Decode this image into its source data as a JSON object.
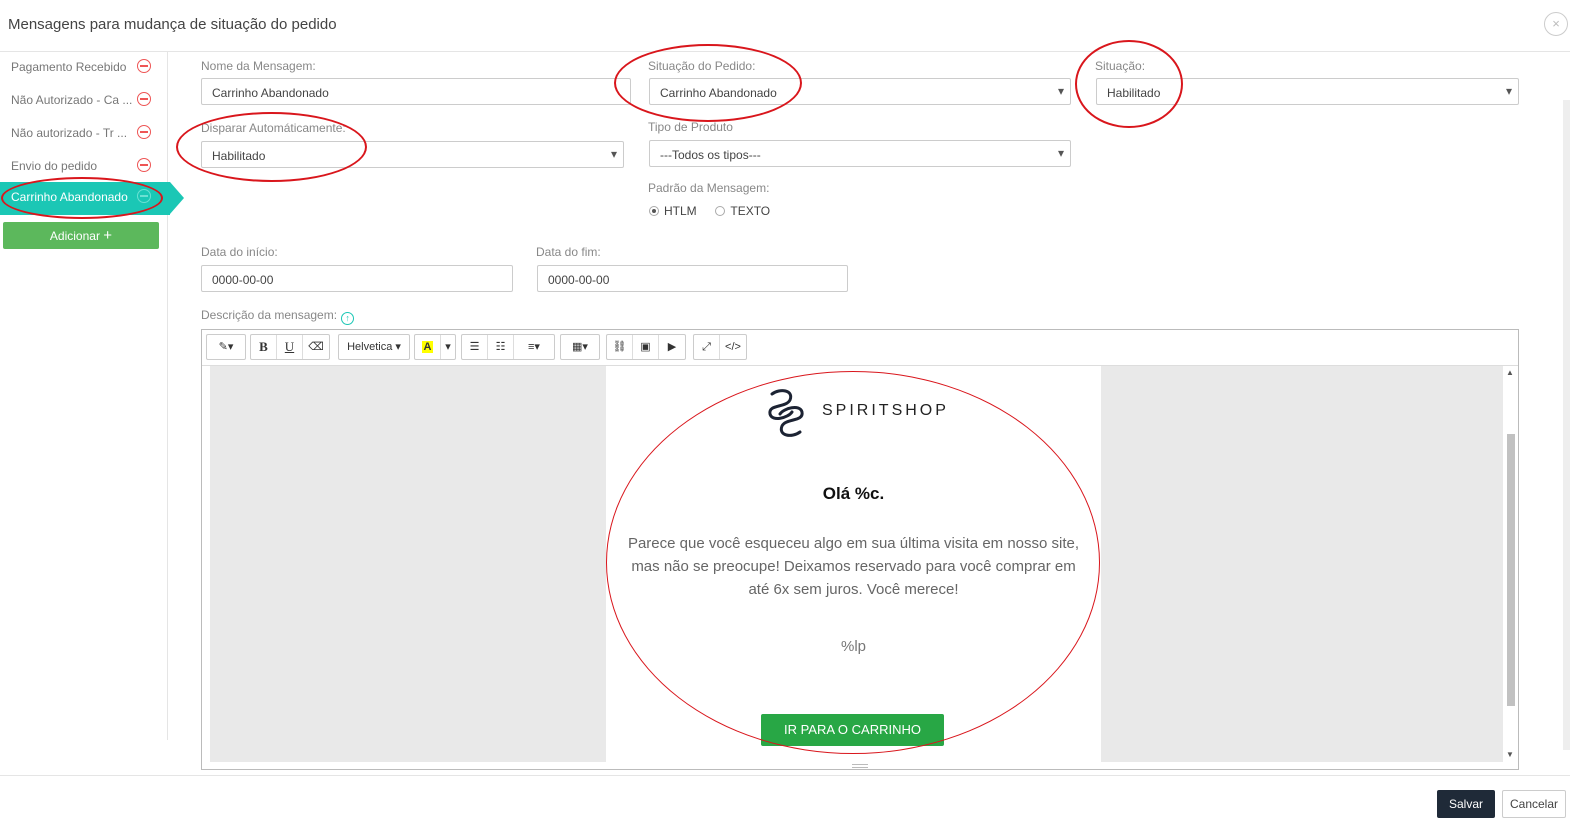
{
  "modal": {
    "title": "Mensagens para mudança de situação do pedido",
    "close_glyph": "×"
  },
  "sidebar": {
    "items": [
      {
        "label": "Pagamento Recebido"
      },
      {
        "label": "Não Autorizado - Ca ..."
      },
      {
        "label": "Não autorizado - Tr ..."
      },
      {
        "label": "Envio do pedido"
      },
      {
        "label": "Carrinho Abandonado",
        "active": true
      }
    ],
    "add_label": "Adicionar",
    "add_icon": "+"
  },
  "form": {
    "nome_label": "Nome da Mensagem:",
    "nome_value": "Carrinho Abandonado",
    "situacao_pedido_label": "Situação do Pedido:",
    "situacao_pedido_value": "Carrinho Abandonado",
    "situacao_label": "Situação:",
    "situacao_value": "Habilitado",
    "disparar_label": "Disparar Automáticamente:",
    "disparar_value": "Habilitado",
    "tipo_produto_label": "Tipo de Produto",
    "tipo_produto_value": "---Todos os tipos---",
    "padrao_label": "Padrão da Mensagem:",
    "padrao_options": [
      "HTLM",
      "TEXTO"
    ],
    "padrao_selected": "HTLM",
    "data_inicio_label": "Data do início:",
    "data_inicio_value": "0000-00-00",
    "data_fim_label": "Data do fim:",
    "data_fim_value": "0000-00-00",
    "descricao_label": "Descrição da mensagem:"
  },
  "toolbar": {
    "magic": "✎▾",
    "bold": "B",
    "underline": "U",
    "eraser": "⌫",
    "font": "Helvetica ▾",
    "color": "A",
    "color_caret": "▾",
    "ul": "☰",
    "ol": "☷",
    "align": "≡▾",
    "table": "▦▾",
    "link": "⛓",
    "image": "▣",
    "video": "▶",
    "fullscreen": "⤢",
    "code": "</>"
  },
  "email": {
    "brand": "SPIRITSHOP",
    "greeting": "Olá %c.",
    "body": "Parece que você esqueceu algo em sua última visita em nosso site, mas não se preocupe! Deixamos reservado para você comprar em até 6x sem juros. Você merece!",
    "placeholder": "%lp",
    "cta": "IR PARA O CARRINHO"
  },
  "footer": {
    "save_label": "Salvar",
    "cancel_label": "Cancelar"
  },
  "colors": {
    "accent": "#1bc7b5",
    "add_button": "#5cb85c",
    "cta": "#28a745",
    "save_button": "#1f2a38",
    "annotation": "#d9161c"
  }
}
